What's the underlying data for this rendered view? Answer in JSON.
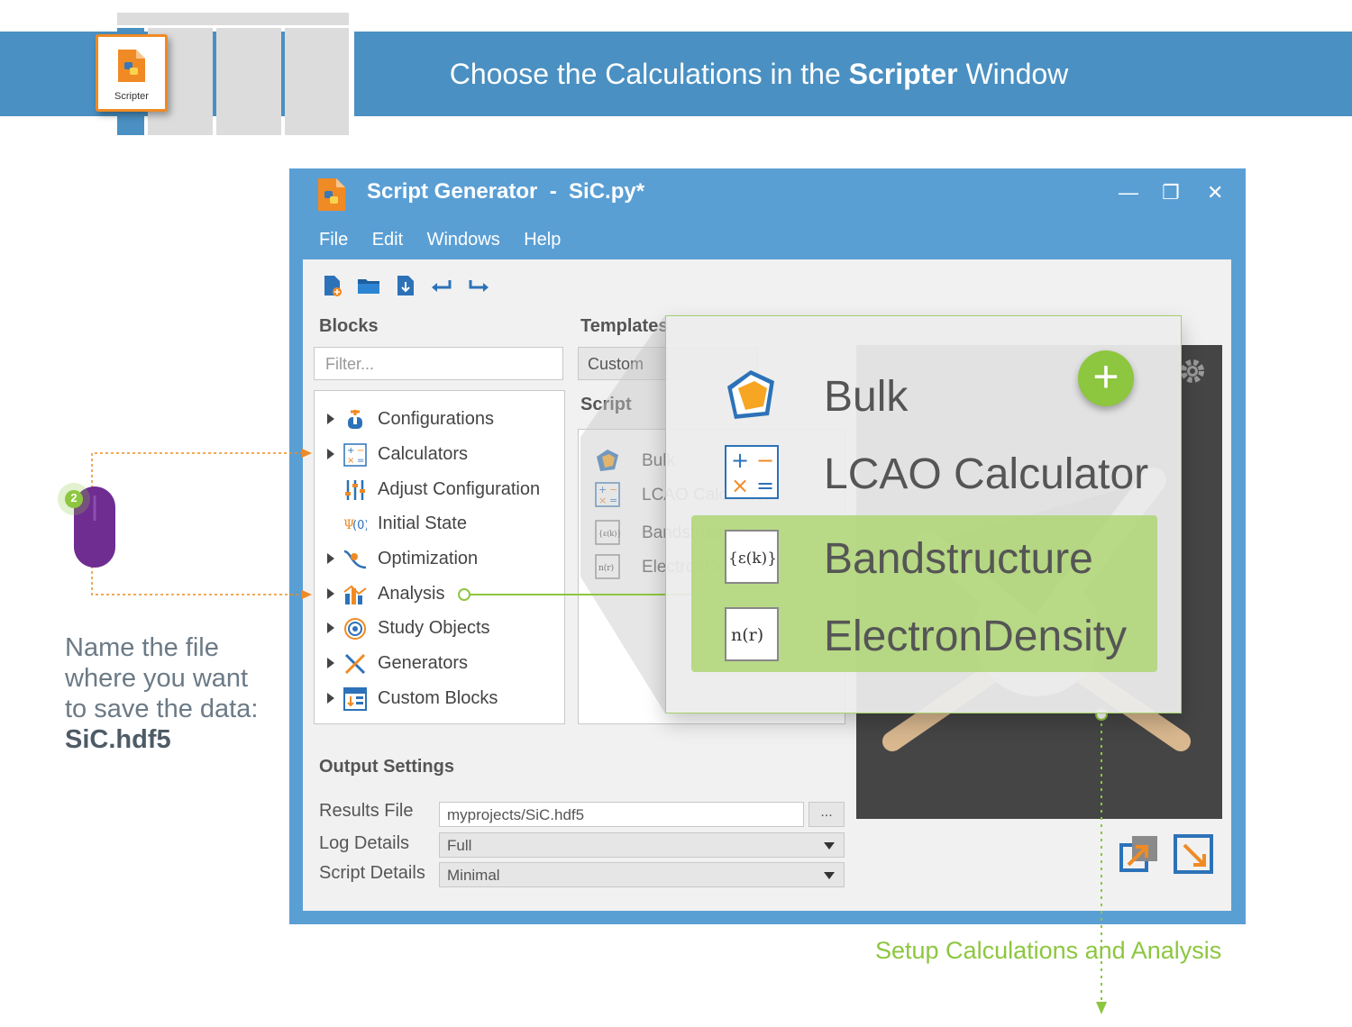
{
  "banner": {
    "title_prefix": "Choose the Calculations in the ",
    "title_bold": "Scripter",
    "title_suffix": " Window"
  },
  "scripter_tile": {
    "label": "Scripter"
  },
  "window": {
    "title": "Script Generator  -  SiC.py*",
    "controls": {
      "minimize": "—",
      "restore": "❐",
      "close": "✕"
    }
  },
  "menu": [
    "File",
    "Edit",
    "Windows",
    "Help"
  ],
  "blocks": {
    "heading": "Blocks",
    "filter_placeholder": "Filter...",
    "items": [
      {
        "label": "Configurations",
        "expandable": true,
        "icon": "configurations-icon"
      },
      {
        "label": "Calculators",
        "expandable": true,
        "icon": "calculators-icon"
      },
      {
        "label": "Adjust Configuration",
        "expandable": false,
        "icon": "adjust-configuration-icon"
      },
      {
        "label": "Initial State",
        "expandable": false,
        "icon": "initial-state-icon"
      },
      {
        "label": "Optimization",
        "expandable": true,
        "icon": "optimization-icon"
      },
      {
        "label": "Analysis",
        "expandable": true,
        "icon": "analysis-icon"
      },
      {
        "label": "Study Objects",
        "expandable": true,
        "icon": "study-objects-icon"
      },
      {
        "label": "Generators",
        "expandable": true,
        "icon": "generators-icon"
      },
      {
        "label": "Custom Blocks",
        "expandable": true,
        "icon": "custom-blocks-icon"
      }
    ]
  },
  "templates": {
    "heading": "Templates",
    "selected": "Custom"
  },
  "script": {
    "heading": "Script",
    "items": [
      "Bulk",
      "LCAO Calculator",
      "Bandstructure",
      "ElectronDensity"
    ]
  },
  "zoom": {
    "items": [
      "Bulk",
      "LCAO Calculator",
      "Bandstructure",
      "ElectronDensity"
    ],
    "add_label": "+"
  },
  "output": {
    "heading": "Output Settings",
    "results_label": "Results File",
    "results_value": "myprojects/SiC.hdf5",
    "browse_label": "...",
    "log_label": "Log Details",
    "log_value": "Full",
    "script_label": "Script Details",
    "script_value": "Minimal"
  },
  "note": {
    "line1": "Name the file",
    "line2": "where you want",
    "line3": "to save the data:",
    "filename": "SiC.hdf5"
  },
  "mouse_step": "2",
  "footer": "Setup Calculations and Analysis",
  "colors": {
    "banner": "#4a90c2",
    "window": "#5a9fd4",
    "accent": "#8dc63f",
    "orange": "#f08a24"
  }
}
